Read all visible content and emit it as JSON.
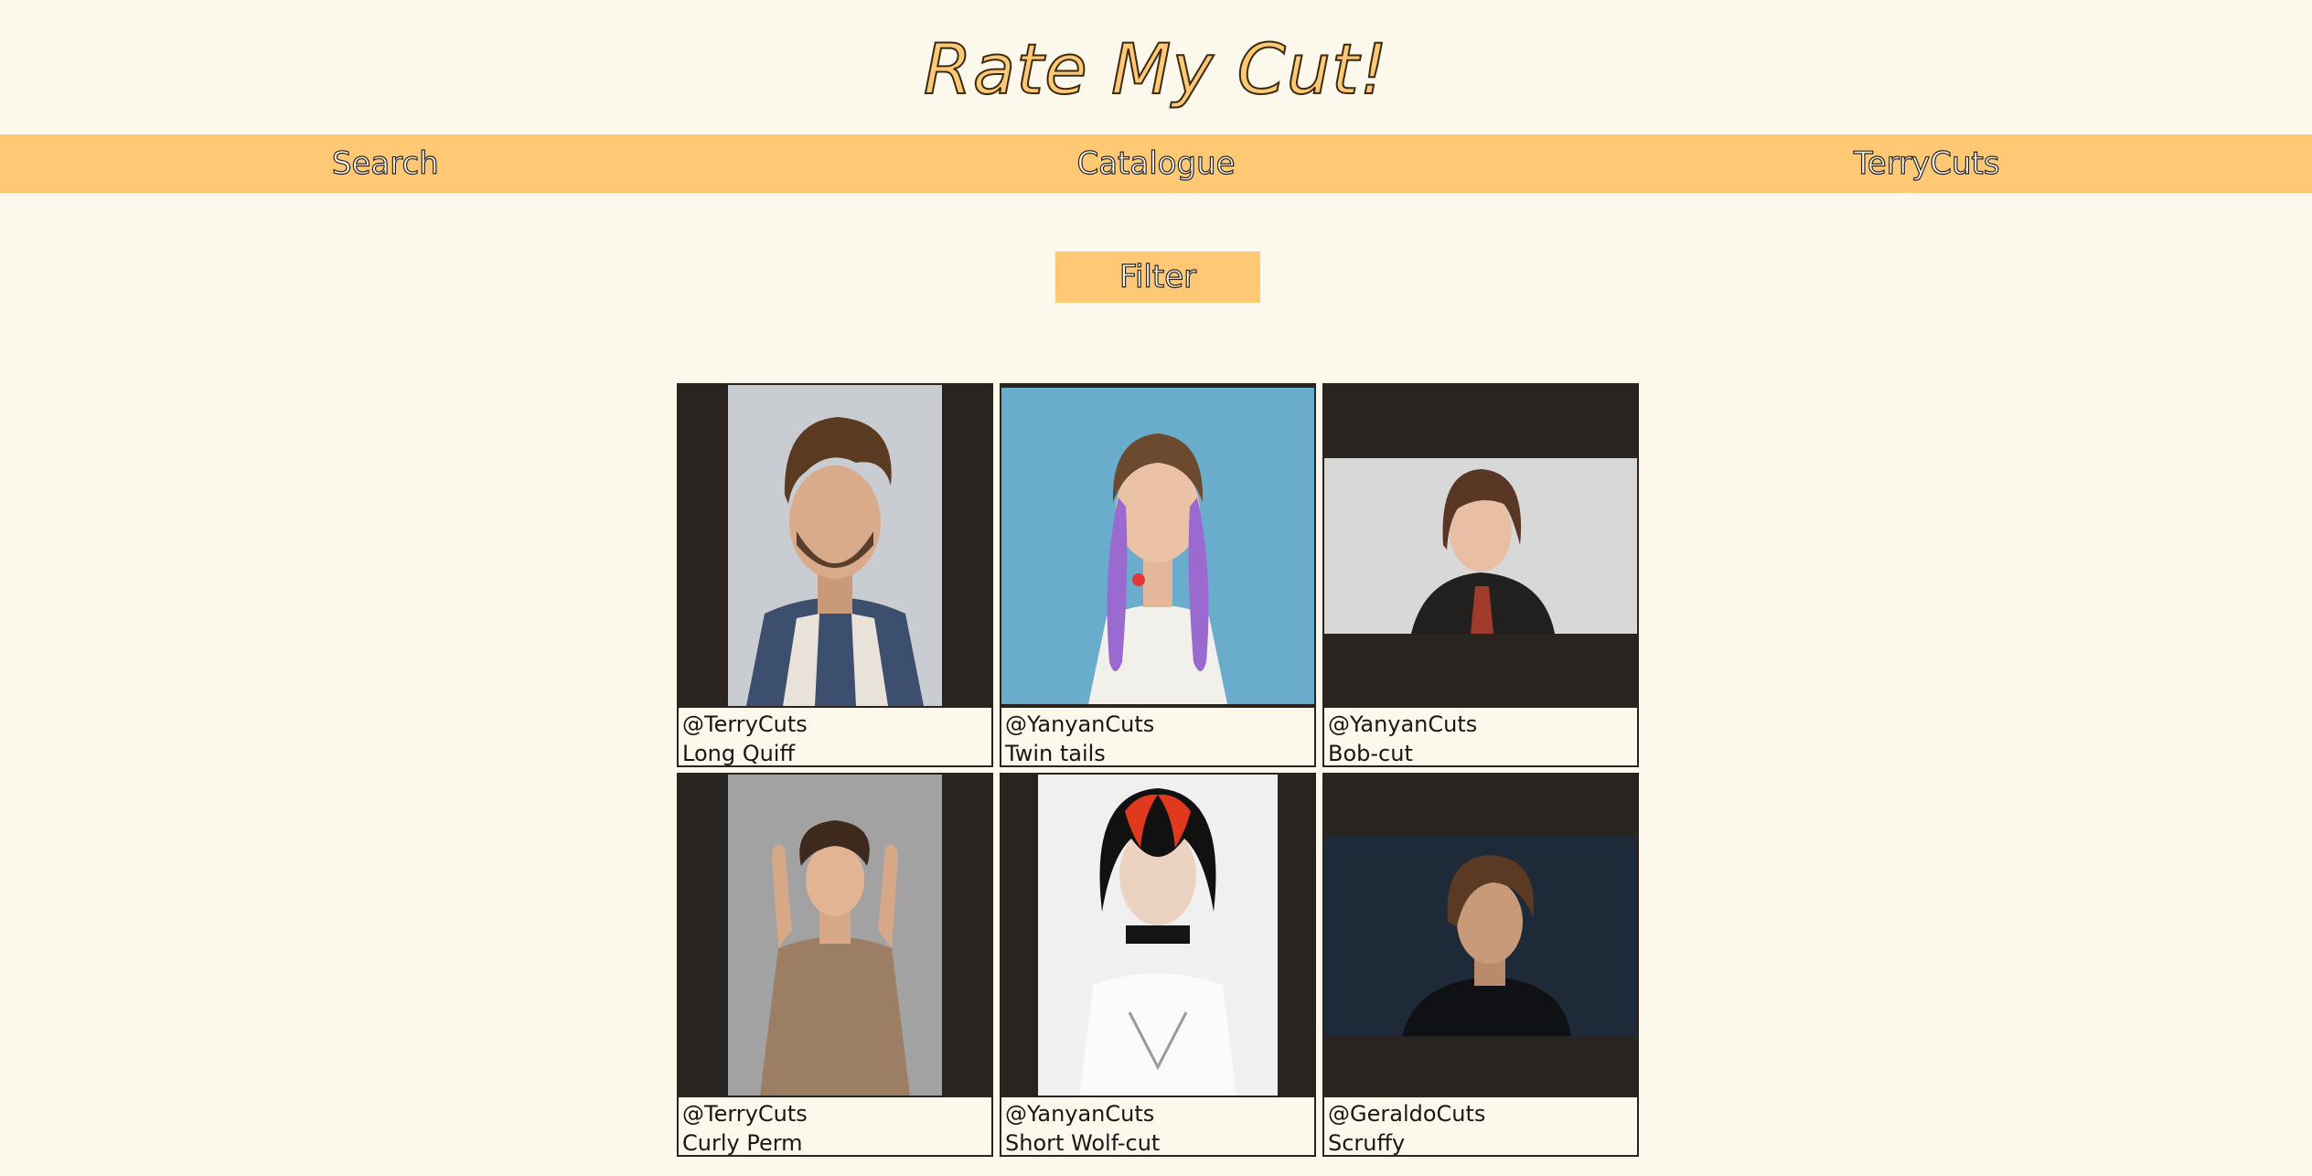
{
  "header": {
    "title": "Rate My Cut!"
  },
  "nav": {
    "items": [
      {
        "label": "Search"
      },
      {
        "label": "Catalogue"
      },
      {
        "label": "TerryCuts"
      }
    ]
  },
  "filter": {
    "label": "Filter"
  },
  "colors": {
    "accent": "#fec874",
    "background": "#fdf8ec",
    "card_frame": "#2a2420",
    "text": "#1a1614"
  },
  "posts": [
    {
      "user": "@TerryCuts",
      "cut": "Long Quiff",
      "photo_icon": "portrait-photo"
    },
    {
      "user": "@YanyanCuts",
      "cut": "Twin tails",
      "photo_icon": "portrait-photo"
    },
    {
      "user": "@YanyanCuts",
      "cut": "Bob-cut",
      "photo_icon": "portrait-photo"
    },
    {
      "user": "@TerryCuts",
      "cut": "Curly Perm",
      "photo_icon": "portrait-photo"
    },
    {
      "user": "@YanyanCuts",
      "cut": "Short Wolf-cut",
      "photo_icon": "portrait-photo"
    },
    {
      "user": "@GeraldoCuts",
      "cut": "Scruffy",
      "photo_icon": "portrait-photo"
    }
  ]
}
